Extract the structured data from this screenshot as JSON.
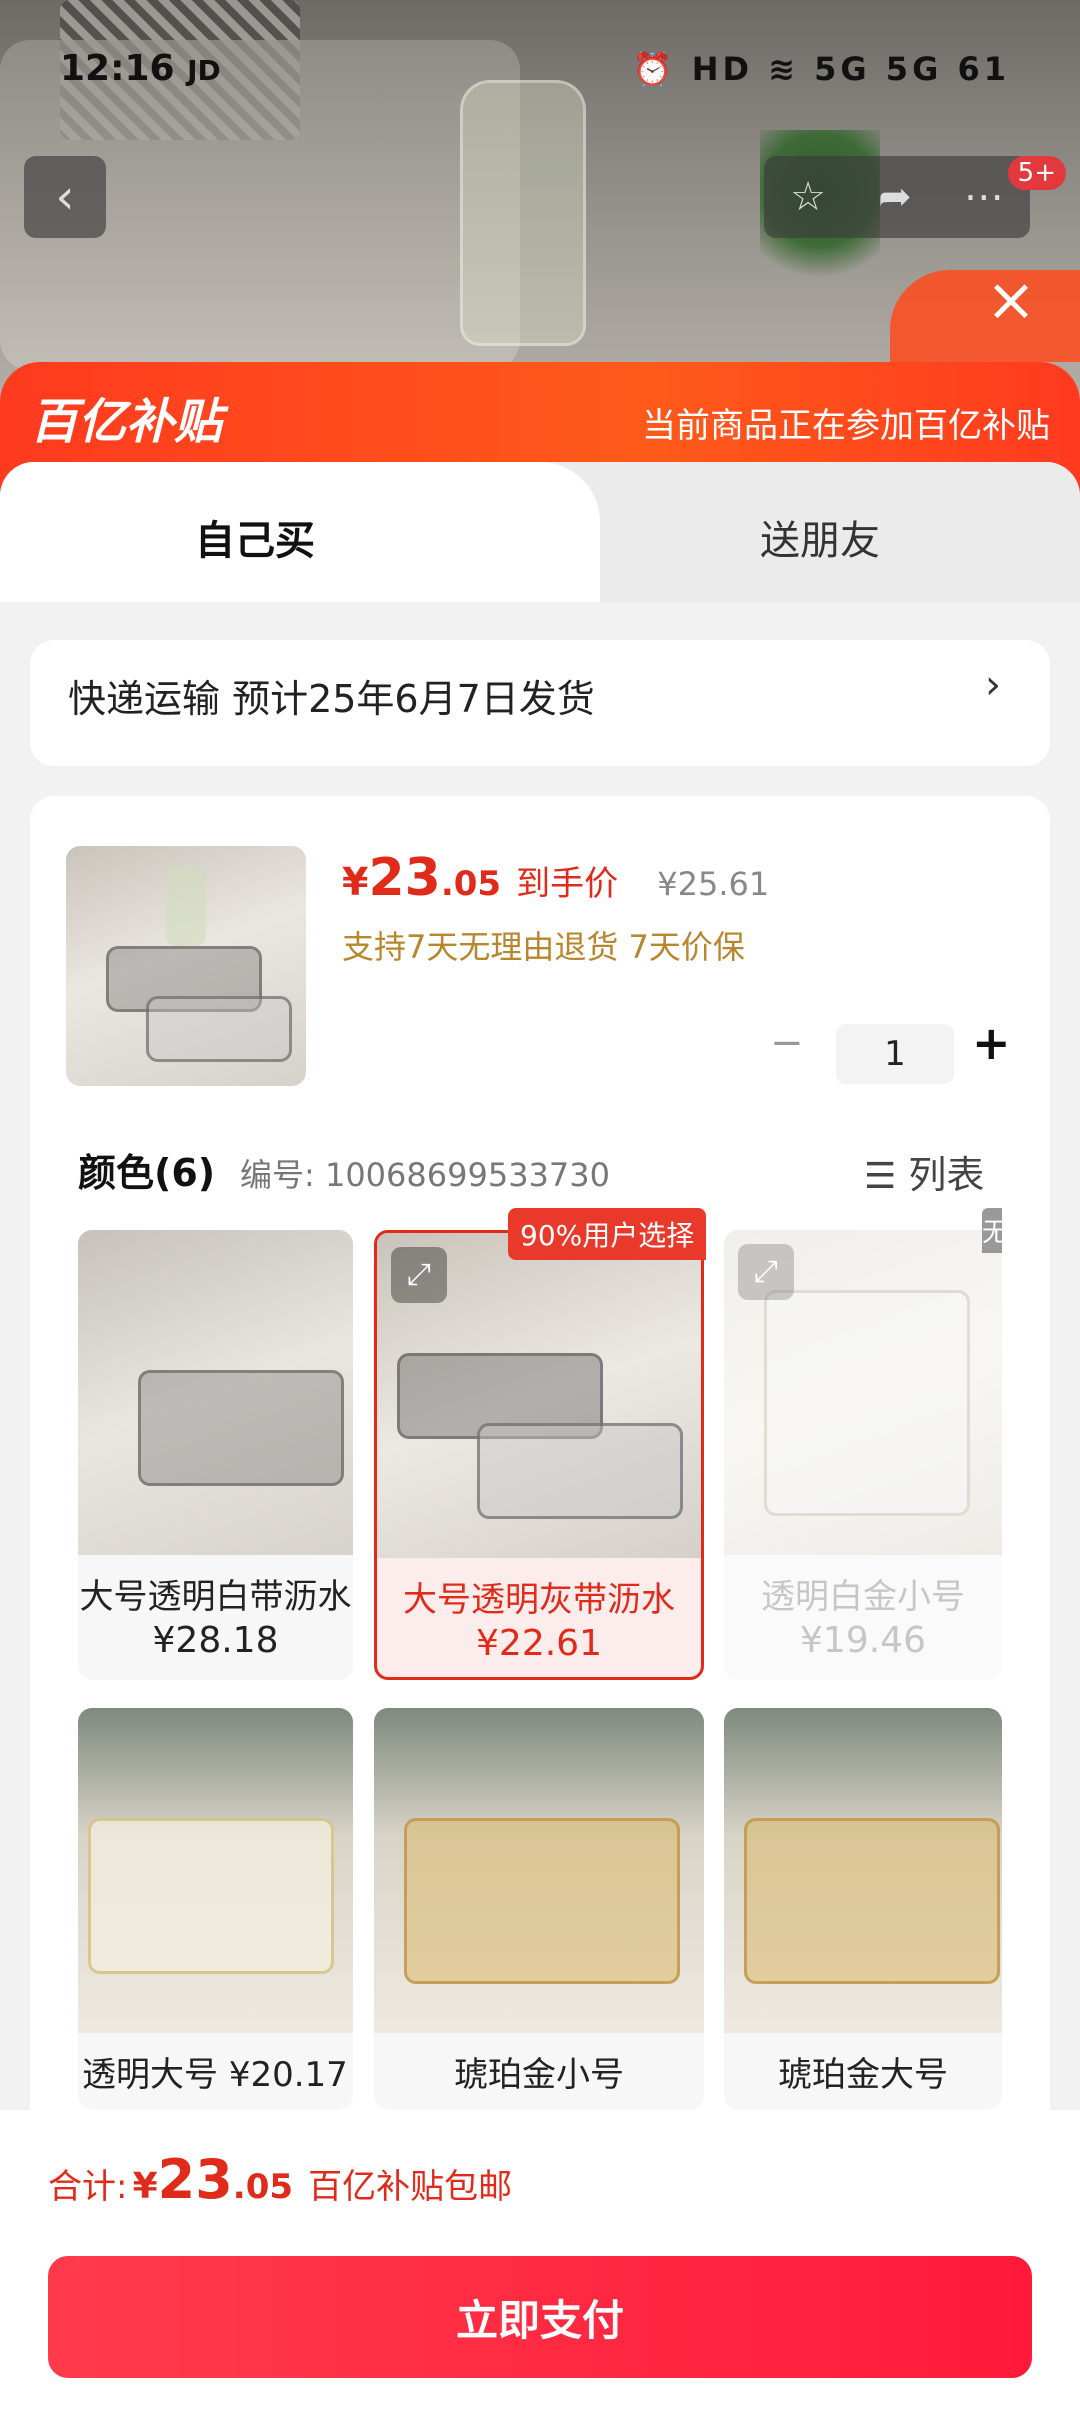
{
  "status_bar": {
    "time": "12:16",
    "carrier_icon": "JD",
    "right_icons": "⏰ HD ≋ 5G 5G 61"
  },
  "header": {
    "badge": "5+"
  },
  "banner": {
    "logo": "百亿补贴",
    "text": "当前商品正在参加百亿补贴"
  },
  "tabs": [
    {
      "label": "自己买"
    },
    {
      "label": "送朋友"
    }
  ],
  "shipping": {
    "text": "快递运输 预计25年6月7日发货",
    "arrow": "›"
  },
  "product": {
    "currency": "¥",
    "price_int": "23",
    "price_dec": ".05",
    "price_label": "到手价",
    "original_price": "¥25.61",
    "guarantee": "支持7天无理由退货 7天价保",
    "quantity": "1",
    "minus": "−",
    "plus": "+"
  },
  "color_section": {
    "title": "颜色(6)",
    "code": "编号: 10068699533730",
    "view_label": "列表"
  },
  "options": [
    {
      "name": "大号透明白带沥水",
      "price": "¥28.18",
      "badge": ""
    },
    {
      "name": "大号透明灰带沥水",
      "price": "¥22.61",
      "badge": "90%用户选择"
    },
    {
      "name": "透明白金小号",
      "price": "¥19.46",
      "badge": "无"
    },
    {
      "name": "透明大号",
      "price": "¥20.17",
      "badge": ""
    },
    {
      "name": "琥珀金小号",
      "price": "",
      "badge": ""
    },
    {
      "name": "琥珀金大号",
      "price": "",
      "badge": ""
    }
  ],
  "footer": {
    "total_label": "合计:",
    "currency": "¥",
    "total_int": "23",
    "total_dec": ".05",
    "note": "百亿补贴包邮",
    "pay_label": "立即支付"
  },
  "colors": {
    "accent": "#e02b1b",
    "banner": "#ff4a1c",
    "pay": "#ff1a3a",
    "gold": "#b8862d"
  }
}
